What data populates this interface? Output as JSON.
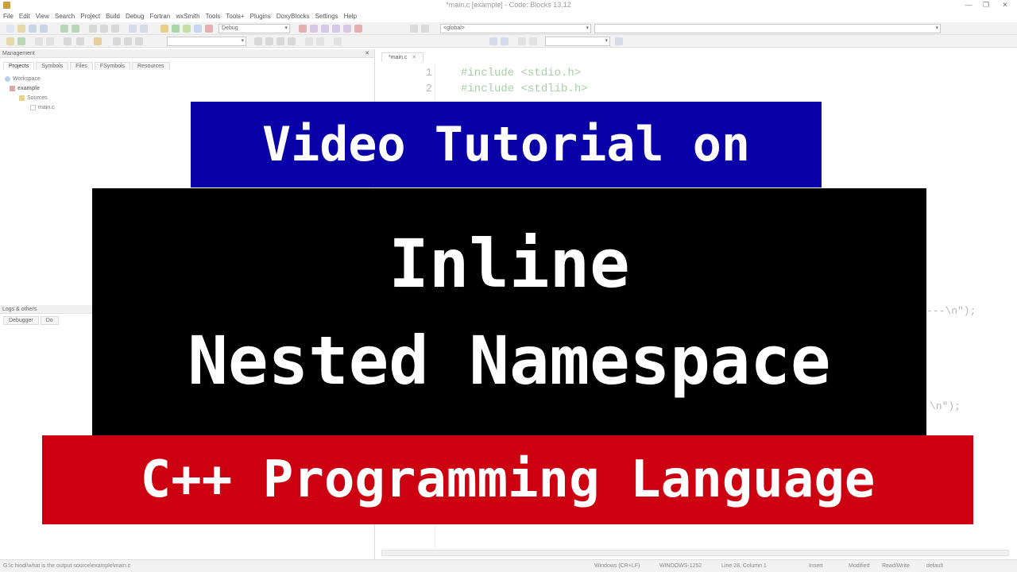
{
  "window": {
    "title": "*main.c [example] - Code::Blocks 13.12"
  },
  "menu": [
    "File",
    "Edit",
    "View",
    "Search",
    "Project",
    "Build",
    "Debug",
    "Fortran",
    "wxSmith",
    "Tools",
    "Tools+",
    "Plugins",
    "DoxyBlocks",
    "Settings",
    "Help"
  ],
  "toolbar": {
    "build_target": "Debug",
    "scope": "<global>"
  },
  "management": {
    "title": "Management",
    "tabs": [
      "Projects",
      "Symbols",
      "Files",
      "FSymbols",
      "Resources"
    ],
    "tree": {
      "workspace": "Workspace",
      "project": "example",
      "folder": "Sources",
      "file": "main.c"
    }
  },
  "logs": {
    "title": "Logs & others",
    "tabs": [
      "Debugger",
      "Do"
    ]
  },
  "editor": {
    "tab_label": "*main.c",
    "lines": [
      {
        "number": "1",
        "text": "#include <stdio.h>"
      },
      {
        "number": "2",
        "text": "#include <stdlib.h>"
      }
    ],
    "fragment_a": "---\\n\");",
    "fragment_b": "\\n\");"
  },
  "statusbar": {
    "path": "G:\\c hindi\\what is the output source\\example\\main.c",
    "line_endings": "Windows (CR+LF)",
    "encoding": "WINDOWS-1252",
    "position": "Line 28, Column 1",
    "insert_mode": "Insert",
    "modified": "Modified",
    "access": "Read/Write",
    "lang": "default"
  },
  "overlay": {
    "top": "Video Tutorial on",
    "main_line1": "Inline",
    "main_line2": "Nested Namespace",
    "bottom": "C++ Programming Language"
  },
  "colors": {
    "top_banner": "#0a00a8",
    "main_banner": "#000000",
    "bottom_banner": "#cc0010",
    "banner_text": "#ffffff"
  }
}
